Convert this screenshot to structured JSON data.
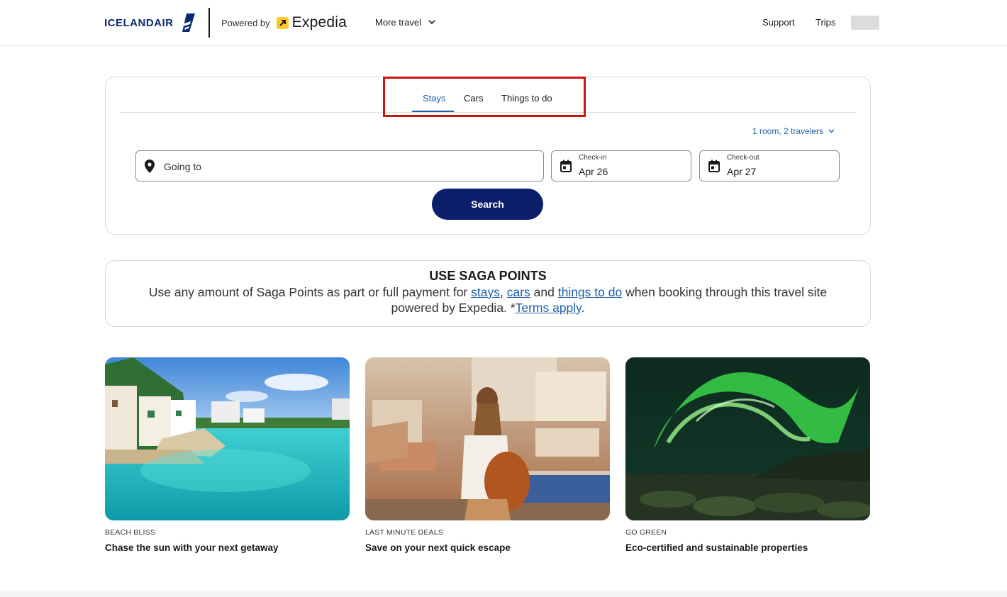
{
  "header": {
    "logo_text": "ICELANDAIR",
    "powered_by": "Powered by",
    "expedia": "Expedia",
    "more_travel": "More travel",
    "support": "Support",
    "trips": "Trips"
  },
  "search": {
    "tabs": [
      {
        "label": "Stays",
        "selected": true
      },
      {
        "label": "Cars",
        "selected": false
      },
      {
        "label": "Things to do",
        "selected": false
      }
    ],
    "travelers": "1 room, 2 travelers",
    "going_to_placeholder": "Going to",
    "checkin_label": "Check-in",
    "checkin_value": "Apr 26",
    "checkout_label": "Check-out",
    "checkout_value": "Apr 27",
    "search_button": "Search"
  },
  "saga": {
    "title": "USE SAGA POINTS",
    "text_1": "Use any amount of Saga Points as part or full payment for ",
    "link_stays": "stays",
    "sep_1": ", ",
    "link_cars": "cars",
    "text_2": " and ",
    "link_things": "things to do",
    "text_3": " when booking through this travel site powered by Expedia. *",
    "link_terms": "Terms apply",
    "text_4": "."
  },
  "cards": [
    {
      "tag": "BEACH BLISS",
      "title": "Chase the sun with your next getaway"
    },
    {
      "tag": "LAST MINUTE DEALS",
      "title": "Save on your next quick escape"
    },
    {
      "tag": "GO GREEN",
      "title": "Eco-certified and sustainable properties"
    }
  ],
  "colors": {
    "brand_navy": "#0d1f6b",
    "link_blue": "#1f5fa8",
    "expedia_yellow": "#ffc72c",
    "highlight_red": "#cc1111"
  }
}
